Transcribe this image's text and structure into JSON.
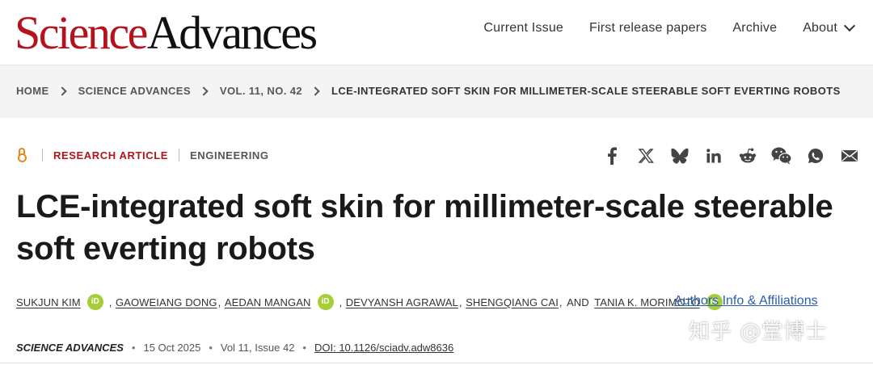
{
  "header": {
    "logo_part1": "Science",
    "logo_part2": "Advances",
    "nav": [
      "Current Issue",
      "First release papers",
      "Archive",
      "About"
    ]
  },
  "breadcrumb": [
    "HOME",
    "SCIENCE ADVANCES",
    "VOL. 11, NO. 42",
    "LCE-INTEGRATED SOFT SKIN FOR MILLIMETER-SCALE STEERABLE SOFT EVERTING ROBOTS"
  ],
  "article": {
    "type": "RESEARCH ARTICLE",
    "subject": "ENGINEERING",
    "title_line1": "LCE-integrated soft skin for millimeter-scale steerable",
    "title_line2": "soft everting robots",
    "authors": {
      "a1": "SUKJUN KIM",
      "a2": "GAOWEIANG DONG",
      "a3": "AEDAN MANGAN",
      "a4": "DEVYANSH AGRAWAL",
      "a5": "SHENGQIANG CAI",
      "a6": "TANIA K. MORIMOTO",
      "and": "AND",
      "orcid": "iD"
    },
    "affiliations_link": "Authors Info & Affiliations",
    "journal": "SCIENCE ADVANCES",
    "date": "15 Oct 2025",
    "volume": "Vol 11, Issue 42",
    "doi": "DOI: 10.1126/sciadv.adw8636"
  },
  "share_icons": [
    "facebook-icon",
    "x-icon",
    "bluesky-icon",
    "linkedin-icon",
    "reddit-icon",
    "wechat-icon",
    "whatsapp-icon",
    "email-icon"
  ],
  "watermark": "知乎 @堂博士",
  "colors": {
    "brand_red": "#b5121b",
    "link_blue": "#2a5db0",
    "orcid_green": "#a6ce39",
    "oa_orange": "#e8861a"
  }
}
